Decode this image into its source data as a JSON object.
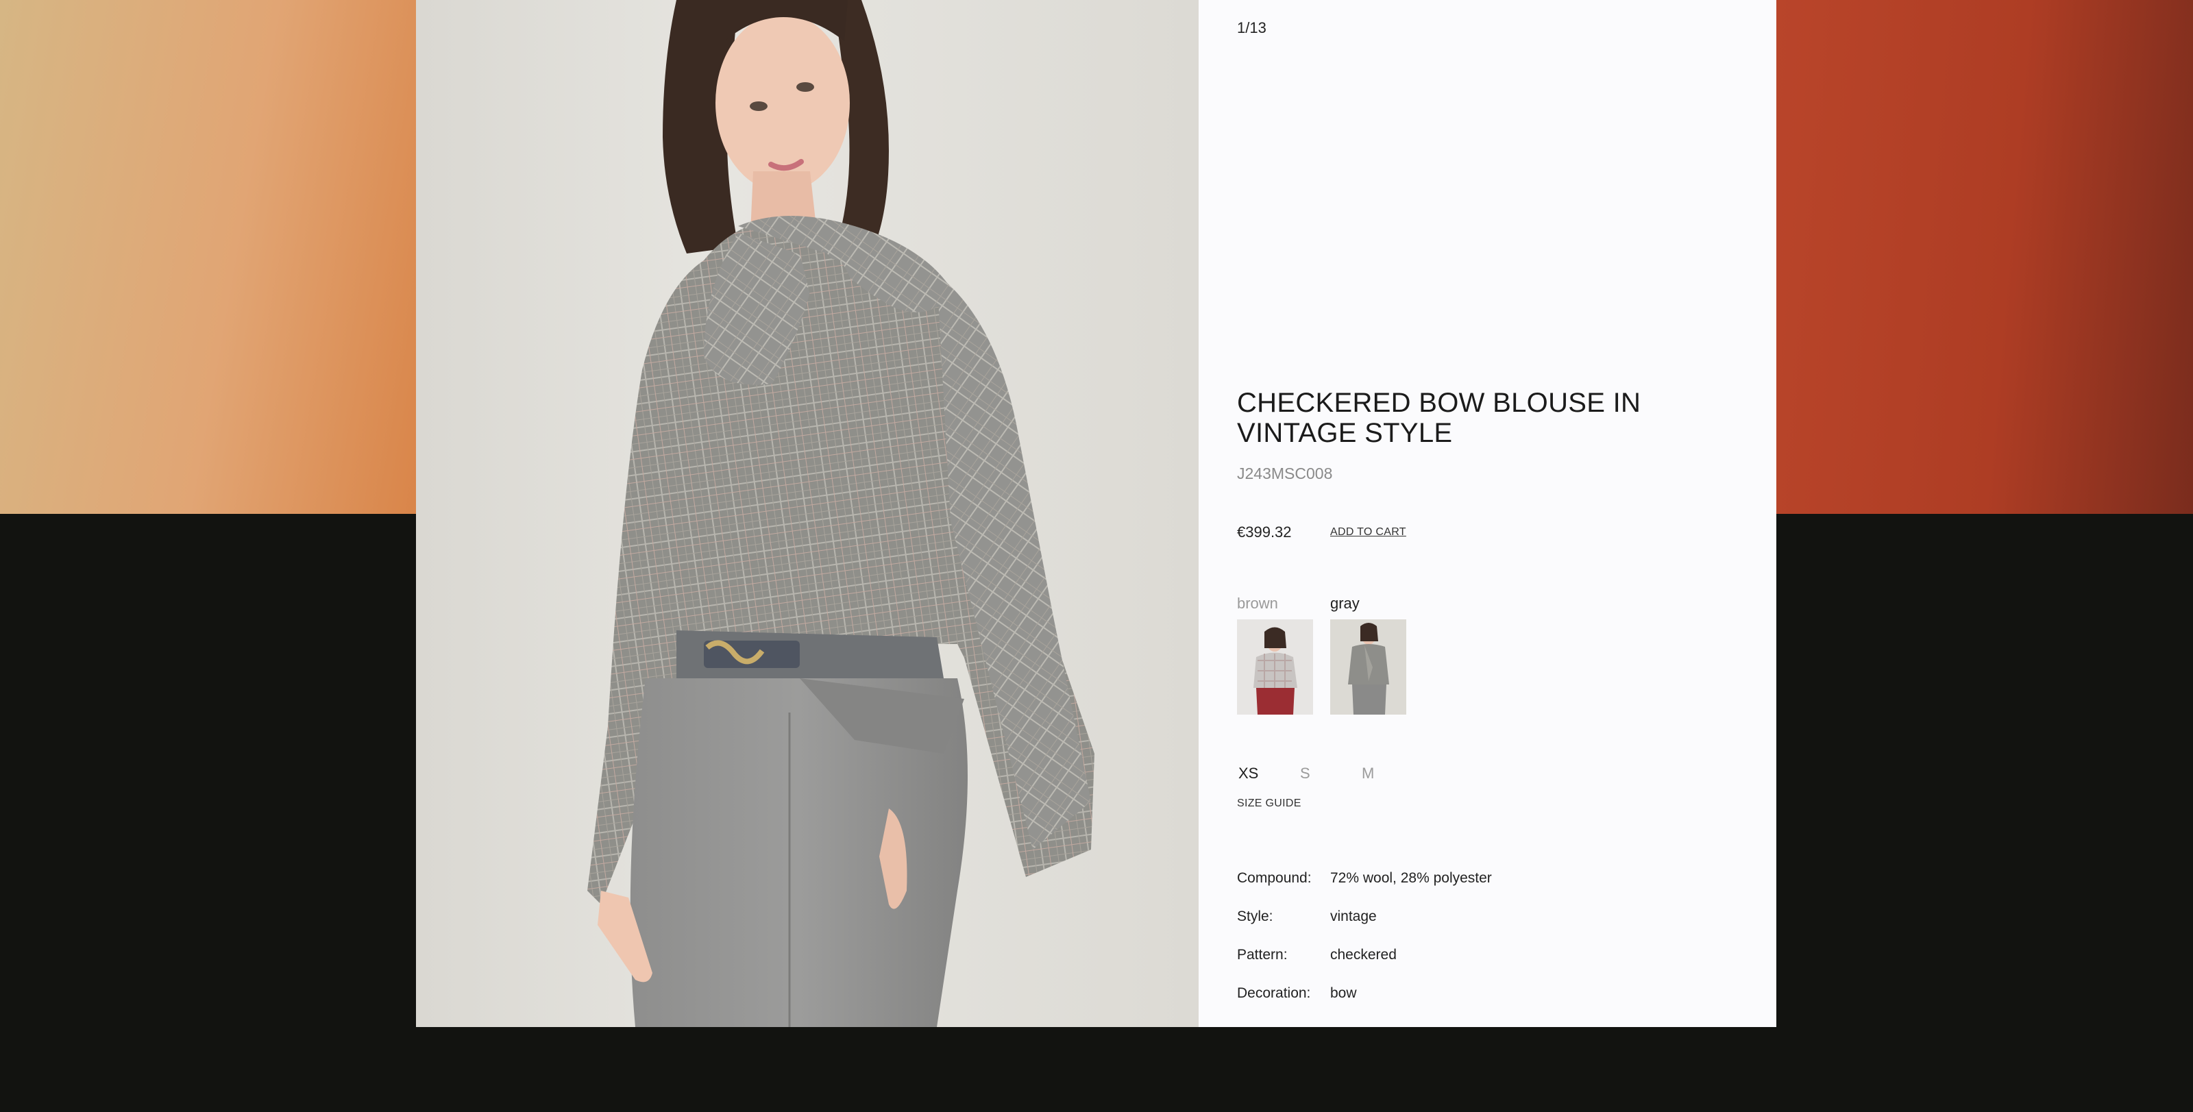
{
  "counter": "1/13",
  "product": {
    "title": "CHECKERED BOW BLOUSE IN VINTAGE STYLE",
    "sku": "J243MSC008",
    "price": "€399.32",
    "add_to_cart": "ADD TO CART"
  },
  "colors": [
    {
      "name": "brown",
      "selected": false
    },
    {
      "name": "gray",
      "selected": true
    }
  ],
  "sizes": [
    {
      "label": "XS",
      "available": true
    },
    {
      "label": "S",
      "available": false
    },
    {
      "label": "M",
      "available": false
    }
  ],
  "size_guide": "SIZE GUIDE",
  "properties": [
    {
      "label": "Compound:",
      "value": "72% wool, 28% polyester"
    },
    {
      "label": "Style:",
      "value": "vintage"
    },
    {
      "label": "Pattern:",
      "value": "checkered"
    },
    {
      "label": "Decoration:",
      "value": "bow"
    }
  ],
  "palette": {
    "page_background": "#121310",
    "panel_background": "#fbfbfd",
    "left_gradient": "#d6b684",
    "right_gradient": "#b9452a"
  }
}
